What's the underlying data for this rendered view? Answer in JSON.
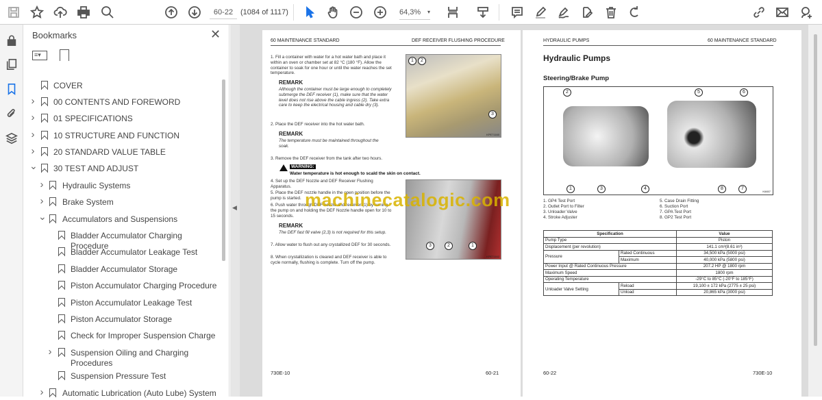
{
  "toolbar": {
    "page_input": "60-22",
    "page_count": "(1084 of 1117)",
    "zoom": "64,3%",
    "icons": [
      "save-icon",
      "bookmark-star-icon",
      "upload-cloud-icon",
      "print-icon",
      "find-icon",
      "prev-page-icon",
      "next-page-icon",
      "select-cursor-icon",
      "hand-icon",
      "zoom-out-icon",
      "zoom-in-icon",
      "page-fit-icon",
      "scroll-mode-icon",
      "comment-icon",
      "highlight-icon",
      "sign-icon",
      "stamp-icon",
      "delete-icon",
      "rotate-icon",
      "share-link-icon",
      "email-icon",
      "add-user-icon"
    ]
  },
  "bookmarks": {
    "title": "Bookmarks",
    "items": [
      {
        "label": "COVER",
        "level": 1,
        "chev": ""
      },
      {
        "label": "00 CONTENTS AND FOREWORD",
        "level": 1,
        "chev": "right"
      },
      {
        "label": "01 SPECIFICATIONS",
        "level": 1,
        "chev": "right"
      },
      {
        "label": "10 STRUCTURE AND FUNCTION",
        "level": 1,
        "chev": "right"
      },
      {
        "label": "20 STANDARD VALUE TABLE",
        "level": 1,
        "chev": "right"
      },
      {
        "label": "30 TEST AND ADJUST",
        "level": 1,
        "chev": "down"
      },
      {
        "label": "Hydraulic Systems",
        "level": 2,
        "chev": "right"
      },
      {
        "label": "Brake System",
        "level": 2,
        "chev": "right"
      },
      {
        "label": "Accumulators and Suspensions",
        "level": 2,
        "chev": "down"
      },
      {
        "label": "Bladder Accumulator Charging Procedure",
        "level": 3,
        "chev": ""
      },
      {
        "label": "Bladder Accumulator Leakage Test",
        "level": 3,
        "chev": ""
      },
      {
        "label": "Bladder Accumulator Storage",
        "level": 3,
        "chev": ""
      },
      {
        "label": "Piston Accumulator Charging Procedure",
        "level": 3,
        "chev": ""
      },
      {
        "label": "Piston Accumulator Leakage Test",
        "level": 3,
        "chev": ""
      },
      {
        "label": "Piston Accumulator Storage",
        "level": 3,
        "chev": ""
      },
      {
        "label": "Check for Improper Suspension Charge",
        "level": 3,
        "chev": ""
      },
      {
        "label": "Suspension Oiling and Charging Procedures",
        "level": 3,
        "chev": "right"
      },
      {
        "label": "Suspension Pressure Test",
        "level": 3,
        "chev": ""
      },
      {
        "label": "Automatic Lubrication (Auto Lube) System",
        "level": 2,
        "chev": "right"
      }
    ]
  },
  "left_page": {
    "header_left": "60 MAINTENANCE STANDARD",
    "header_right": "DEF RECEIVER FLUSHING PROCEDURE",
    "step1": "1.   Fill a container with water for a hot water bath and place it within an oven or chamber set at 82 °C (180 °F). Allow the container to soak for one hour or until the water reaches the set temperature.",
    "remark_label": "REMARK",
    "remark1": "Although the container must be large enough to completely submerge the DEF receiver (1), make sure that the water level does not rise above the cable ingress (2). Take extra care to keep the electrical housing and cable dry (3).",
    "step2": "2.   Place the DEF receiver into the hot water bath.",
    "remark2": "The temperature must be maintained throughout the soak.",
    "step3": "3.   Remove the DEF receiver from the tank after two hours.",
    "warning_label": "WARNING:",
    "warning_text": "Water temperature is hot enough to scald the skin on contact.",
    "step4": "4.   Set up the DEF Nozzle and DEF Receiver Flushing Apparatus.",
    "step5": "5.   Place the DEF nozzle handle in the open position before the pump is started.",
    "step6": "6.   Push water through DEF nozzle and receiver (1) by turning the pump on and holding the DEF Nozzle handle open for 10 to 15 seconds.",
    "remark3": "The DEF fast fill valve (2,3) is not required for this setup.",
    "step7": "7.   Allow water to flush out any crystallized DEF for 30 seconds.",
    "step8": "8.   When crystallization is cleared and DEF receiver is able to cycle normally, flushing is complete. Turn off the pump.",
    "photo1_callouts": [
      "1",
      "2",
      "3"
    ],
    "photo1_code": "KPE71160",
    "photo2_callouts": [
      "3",
      "2",
      "1"
    ],
    "photo2_code": "KPE71162",
    "footer_left": "730E-10",
    "footer_right": "60-21"
  },
  "right_page": {
    "header_left": "HYDRAULIC PUMPS",
    "header_right": "60 MAINTENANCE STANDARD",
    "title": "Hydraulic Pumps",
    "subtitle": "Steering/Brake Pump",
    "callouts": [
      "2",
      "5",
      "6",
      "1",
      "3",
      "4",
      "8",
      "7"
    ],
    "figure_code": "K6657",
    "legend": [
      "1.   GP4 Test Port",
      "2.   Outlet Port to Filter",
      "3.   Unloader Valve",
      "4.   Stroke Adjuster",
      "5.   Case Drain Fitting",
      "6.   Suction Port",
      "7.   GPA Test Port",
      "8.   GP2 Test Port"
    ],
    "table": {
      "head": [
        "Specification",
        "Value"
      ],
      "pump_type": [
        "Pump Type",
        "Piston"
      ],
      "displacement": [
        "Displacement (per revolution)",
        "141.1 cm³(8.61 in³)"
      ],
      "pressure": "Pressure",
      "rated": [
        "Rated Continuous",
        "34,500 kPa (5000 psi)"
      ],
      "max": [
        "Maximum",
        "40,000 kPa (5800 psi)"
      ],
      "power": [
        "Power Input @ Rated Continuous Pressure",
        "207.2 HP @ 1800 rpm"
      ],
      "speed": [
        "Maximum Speed",
        "1800 rpm"
      ],
      "temp": [
        "Operating Temperature",
        "-29°C to 85°C (-20°F to 185°F)"
      ],
      "unloader": "Unloader Valve Setting",
      "reload": [
        "Reload",
        "19,100 ± 172 kPa (2775 ± 25 psi)"
      ],
      "unload": [
        "Unload",
        "20,865 kPa (3000 psi)"
      ]
    },
    "footer_left": "60-22",
    "footer_right": "730E-10"
  },
  "watermark": "machinecatalogic.com"
}
